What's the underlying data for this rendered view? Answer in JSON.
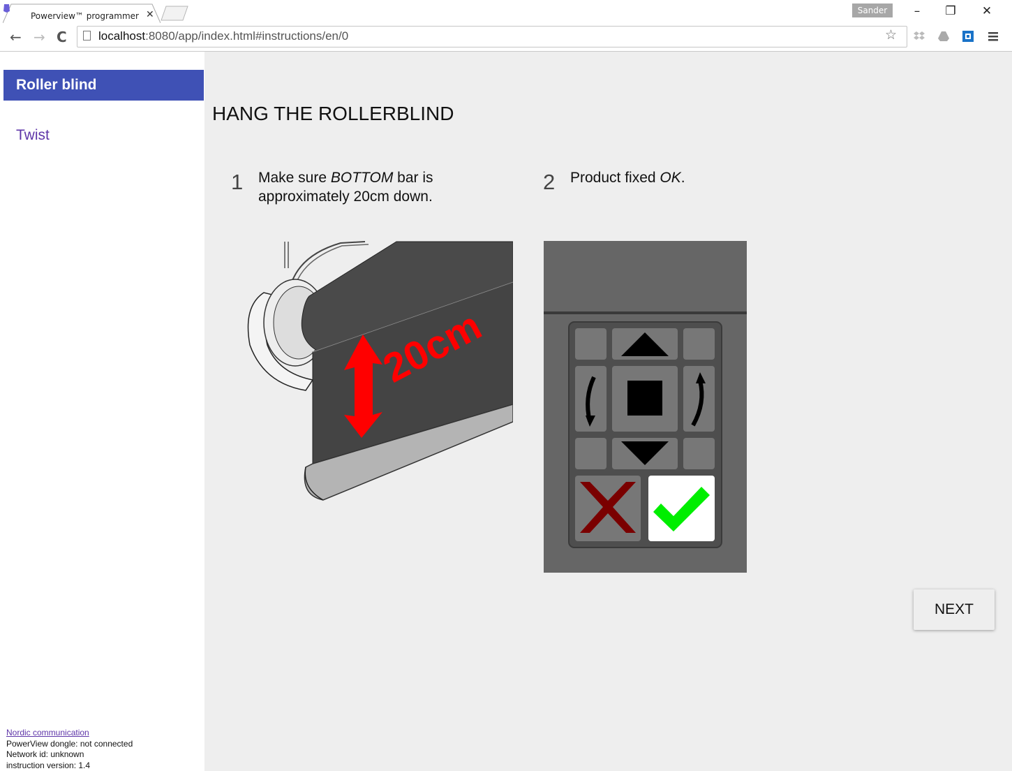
{
  "browser": {
    "tab_title": "Powerview™ programmer",
    "tab_close": "✕",
    "profile_name": "Sander",
    "url_host": "localhost",
    "url_rest": ":8080/app/index.html#instructions/en/0",
    "window_controls": {
      "minimize": "–",
      "restore": "❐",
      "close": "✕"
    },
    "nav": {
      "back": "←",
      "forward": "→",
      "reload": "C"
    }
  },
  "sidebar": {
    "items": [
      {
        "label": "Roller blind",
        "active": true
      },
      {
        "label": "Twist",
        "active": false
      }
    ],
    "footer": {
      "link": "Nordic communication",
      "dongle_status": "PowerView dongle: not connected",
      "network": "Network id: unknown",
      "version": "instruction version: 1.4"
    }
  },
  "main": {
    "title": "HANG THE ROLLERBLIND",
    "steps": [
      {
        "number": "1",
        "line1_pre": "Make sure ",
        "line1_em": "BOTTOM",
        "line1_post": " bar is",
        "line2": "approximately 20cm down."
      },
      {
        "number": "2",
        "line1_pre": "Product fixed ",
        "line1_em": "OK",
        "line1_post": "."
      }
    ],
    "illustration_label": "20cm",
    "next_label": "NEXT"
  },
  "colors": {
    "accent": "#3f51b5",
    "link": "#5e35a8",
    "content_bg": "#eeeeee",
    "arrow_red": "#ff0000",
    "check_green": "#00ee00",
    "cross_red": "#7a0000"
  }
}
